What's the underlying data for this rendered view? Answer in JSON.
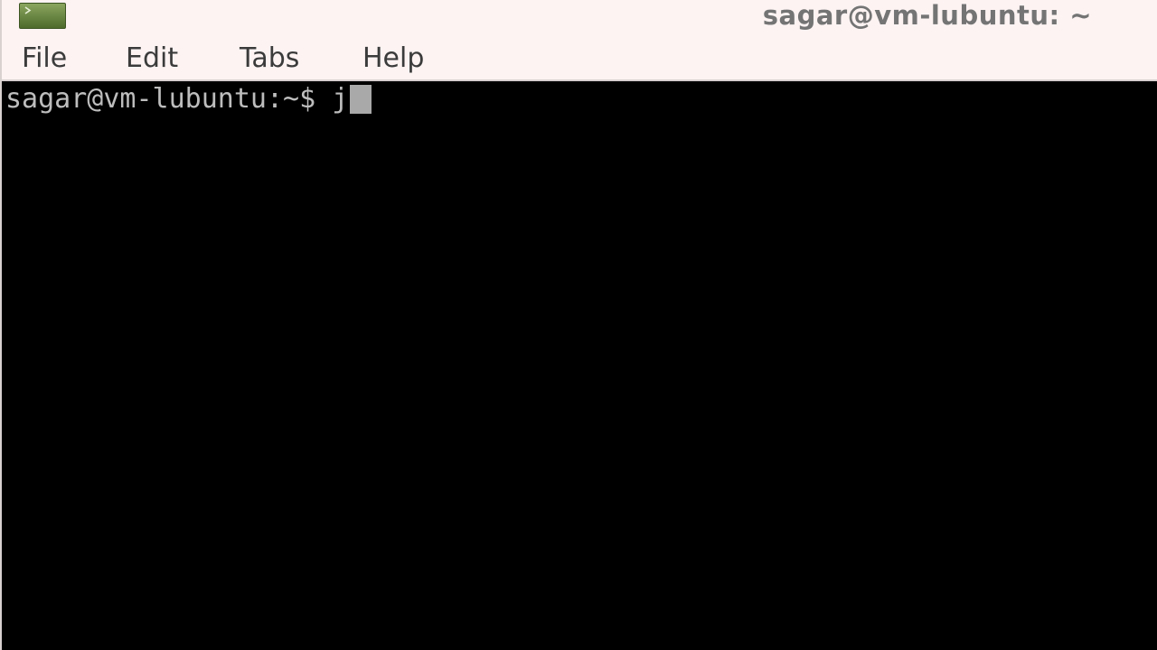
{
  "window": {
    "title": "sagar@vm-lubuntu: ~",
    "icon": "terminal-icon"
  },
  "menu": {
    "file": "File",
    "edit": "Edit",
    "tabs": "Tabs",
    "help": "Help"
  },
  "terminal": {
    "prompt": "sagar@vm-lubuntu:~$ ",
    "input": "j",
    "colors": {
      "background": "#000000",
      "foreground": "#bdbdbd",
      "cursor": "#a9a9a9"
    }
  }
}
